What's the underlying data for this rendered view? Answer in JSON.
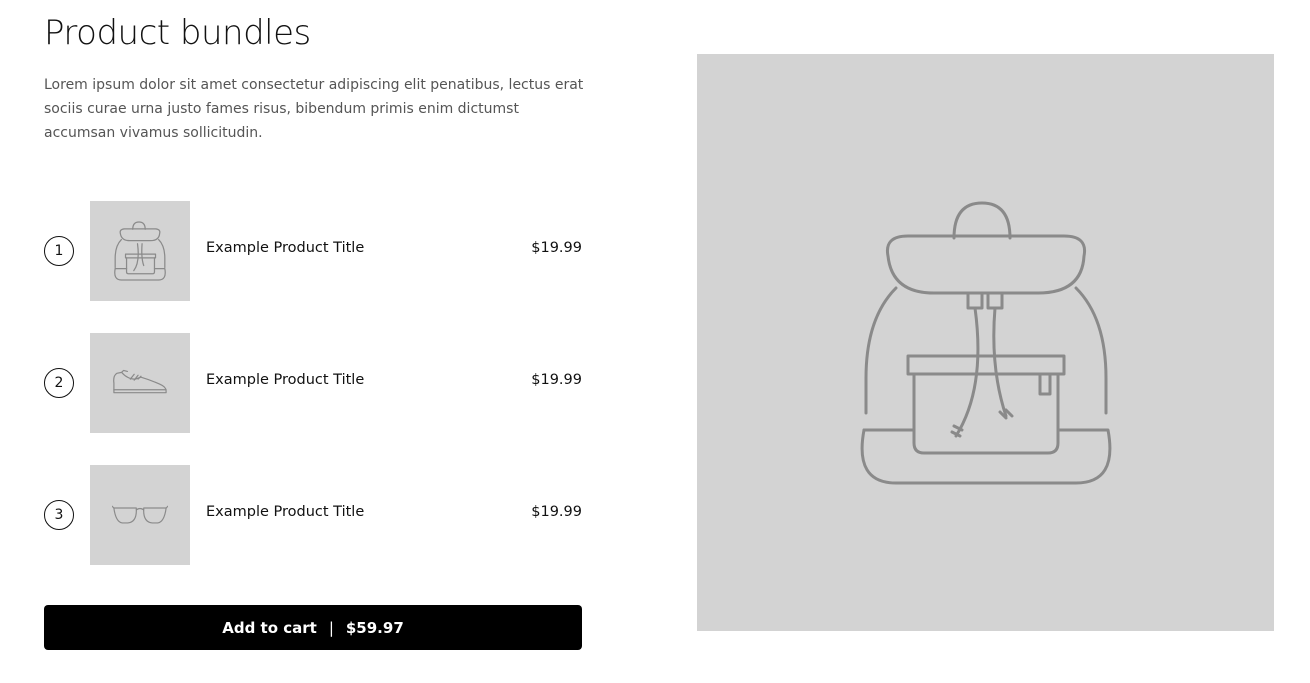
{
  "section": {
    "title": "Product bundles",
    "description": "Lorem ipsum dolor sit amet consectetur adipiscing elit penatibus, lectus erat sociis curae urna justo fames risus, bibendum primis enim dictumst accumsan vivamus sollicitudin."
  },
  "items": [
    {
      "number": "1",
      "icon": "backpack-icon",
      "title": "Example Product Title",
      "price": "$19.99"
    },
    {
      "number": "2",
      "icon": "sneaker-icon",
      "title": "Example Product Title",
      "price": "$19.99"
    },
    {
      "number": "3",
      "icon": "glasses-icon",
      "title": "Example Product Title",
      "price": "$19.99"
    }
  ],
  "cart": {
    "label": "Add to cart",
    "separator": "|",
    "total": "$59.97"
  },
  "hero": {
    "icon": "backpack-icon"
  },
  "colors": {
    "placeholder_bg": "#d3d3d3",
    "icon_stroke": "#8a8a8a",
    "button_bg": "#000000",
    "button_text": "#ffffff"
  }
}
